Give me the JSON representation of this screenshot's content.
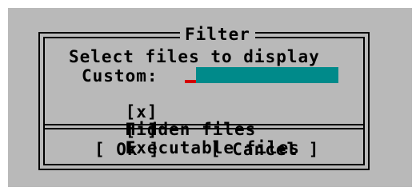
{
  "dialog": {
    "title": "Filter",
    "heading": "Select files to display",
    "custom_label": "Custom:",
    "custom_value": "",
    "hidden_files": {
      "mark": "[x]",
      "label": "Hidden files",
      "checked": true
    },
    "executable_files": {
      "mark": "[ ]",
      "label": "Executable files",
      "checked": false
    },
    "ok_label": "[ Ok ]",
    "cancel_label": "[ Cancel ]"
  },
  "colors": {
    "dialog_background": "#b9b9b9",
    "input_background": "#008a8a",
    "cursor": "#d40000",
    "text": "#000000"
  }
}
